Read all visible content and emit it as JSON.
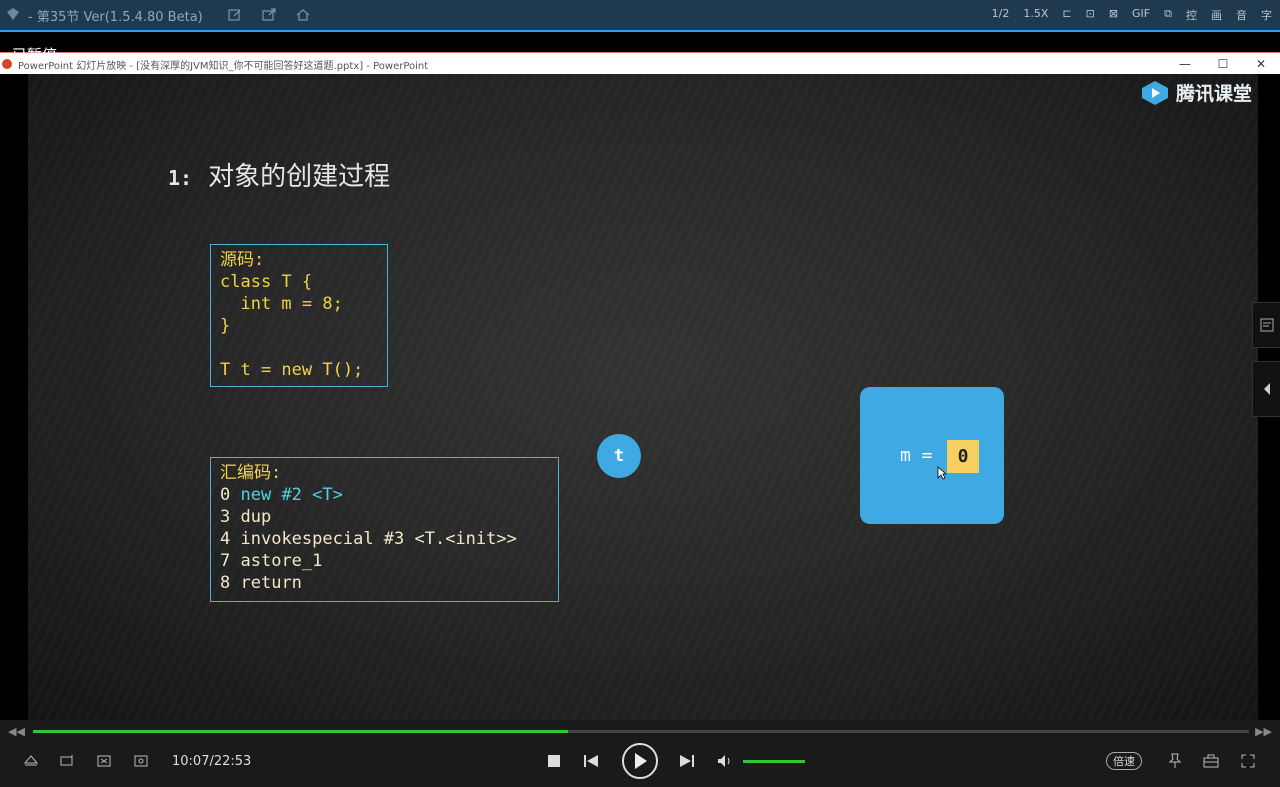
{
  "player": {
    "title": "- 第35节 Ver(1.5.4.80 Beta)",
    "status_overlay": "已暂停",
    "right_tools": [
      "1/2",
      "1.5X",
      "口",
      "口",
      "口",
      "GIF",
      "口",
      "控",
      "画",
      "音",
      "字"
    ]
  },
  "ppt_window": {
    "title": "PowerPoint 幻灯片放映 - [没有深厚的JVM知识_你不可能回答好这道题.pptx] - PowerPoint",
    "controls": [
      "—",
      "☐",
      "✕"
    ]
  },
  "slide": {
    "brand": "腾讯课堂",
    "title_number": "1:",
    "title_text": "对象的创建过程",
    "source_box": {
      "lines": [
        "源码:",
        "class T {",
        "  int m = 8;",
        "}",
        "",
        "T t = new T();"
      ]
    },
    "asm_box": {
      "header": "汇编码:",
      "rows": [
        {
          "offset": "0",
          "instr": "new #2 <T>"
        },
        {
          "offset": "3",
          "instr": "dup"
        },
        {
          "offset": "4",
          "instr": "invokespecial #3 <T.<init>>"
        },
        {
          "offset": "7",
          "instr": "astore_1"
        },
        {
          "offset": "8",
          "instr": "return"
        }
      ]
    },
    "ref_circle": "t",
    "object": {
      "field_label": "m =",
      "field_value": "0"
    }
  },
  "controls": {
    "time": "10:07/22:53",
    "progress": 0.44,
    "volume": 1.0,
    "speed_label": "倍速",
    "accent": "#37c337"
  }
}
